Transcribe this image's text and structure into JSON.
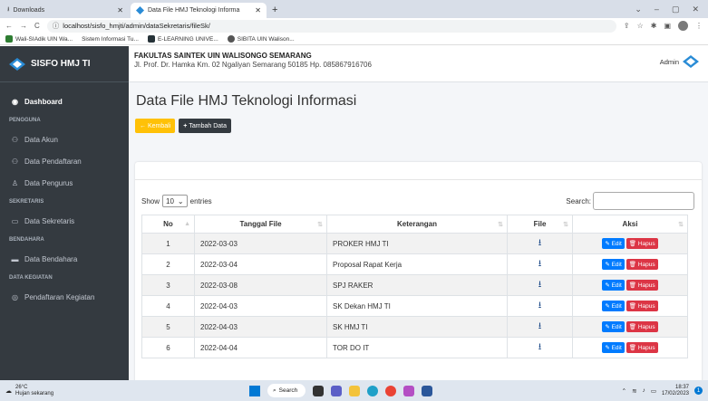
{
  "browser": {
    "tab1": "Downloads",
    "tab2": "Data File HMJ Teknologi Informa",
    "url": "localhost/sisfo_hmjti/admin/dataSekretaris/fileSk/",
    "bookmarks": [
      "Wali-SIAdik UIN Wa...",
      "Sistem Informasi Tu...",
      "E-LEARNING UNIVE...",
      "SIBITA UIN Walison..."
    ]
  },
  "sidebar": {
    "brand": "SISFO HMJ TI",
    "items": [
      {
        "type": "item",
        "label": "Dashboard",
        "icon": "tachometer-icon",
        "glyph": "◉",
        "active": true
      },
      {
        "type": "head",
        "label": "PENGGUNA"
      },
      {
        "type": "item",
        "label": "Data Akun",
        "icon": "users-icon",
        "glyph": "⚇"
      },
      {
        "type": "item",
        "label": "Data Pendaftaran",
        "icon": "user-plus-icon",
        "glyph": "⚇"
      },
      {
        "type": "item",
        "label": "Data Pengurus",
        "icon": "user-icon",
        "glyph": "♙"
      },
      {
        "type": "head",
        "label": "SEKRETARIS"
      },
      {
        "type": "item",
        "label": "Data Sekretaris",
        "icon": "folder-icon",
        "glyph": "▭"
      },
      {
        "type": "head",
        "label": "BENDAHARA"
      },
      {
        "type": "item",
        "label": "Data Bendahara",
        "icon": "money-icon",
        "glyph": "▬"
      },
      {
        "type": "head",
        "label": "DATA KEGIATAN"
      },
      {
        "type": "item",
        "label": "Pendaftaran Kegiatan",
        "icon": "circle-icon",
        "glyph": "◎"
      }
    ]
  },
  "header": {
    "faculty": "FAKULTAS SAINTEK UIN WALISONGO SEMARANG",
    "address": "Jl. Prof. Dr. Hamka Km. 02 Ngaliyan Semarang 50185 Hp. 085867916706",
    "user": "Admin"
  },
  "page": {
    "title": "Data File HMJ Teknologi Informasi",
    "back_label": "Kembali",
    "add_label": "Tambah Data",
    "show_label": "Show",
    "entries_value": "10",
    "entries_label": "entries",
    "search_label": "Search:"
  },
  "table": {
    "headers": [
      "No",
      "Tanggal File",
      "Keterangan",
      "File",
      "Aksi"
    ],
    "rows": [
      {
        "no": "1",
        "tanggal": "2022-03-03",
        "ket": "PROKER HMJ TI"
      },
      {
        "no": "2",
        "tanggal": "2022-03-04",
        "ket": "Proposal Rapat Kerja"
      },
      {
        "no": "3",
        "tanggal": "2022-03-08",
        "ket": "SPJ RAKER"
      },
      {
        "no": "4",
        "tanggal": "2022-04-03",
        "ket": "SK Dekan HMJ TI"
      },
      {
        "no": "5",
        "tanggal": "2022-04-03",
        "ket": "SK HMJ TI"
      },
      {
        "no": "6",
        "tanggal": "2022-04-04",
        "ket": "TOR DO IT"
      }
    ],
    "edit_label": "Edit",
    "hapus_label": "Hapus"
  },
  "taskbar": {
    "temp": "26°C",
    "weather": "Hujan sekarang",
    "search": "Search",
    "time": "18:37",
    "date": "17/02/2023"
  }
}
